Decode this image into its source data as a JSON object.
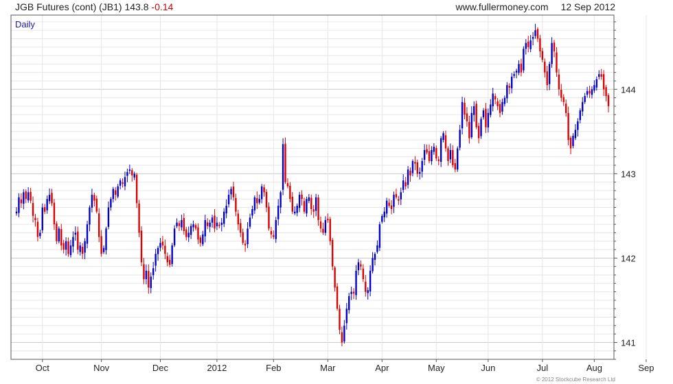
{
  "header": {
    "instrument": "JGB Futures (cont) (JB1)",
    "last": "143.8",
    "change": "-0.14",
    "site": "www.fullermoney.com",
    "date": "12 Sep 2012"
  },
  "footer": {
    "copyright": "© 2012 Stockcube Research Ltd"
  },
  "colors": {
    "up": "#0000cc",
    "down": "#dd0000",
    "grid": "#e6e6e6",
    "major_grid": "#c8c8c8",
    "frame": "#555555"
  },
  "chart_data": {
    "type": "candlestick",
    "title": "Daily",
    "x_tick_labels": [
      "Oct",
      "Nov",
      "Dec",
      "2012",
      "Feb",
      "Mar",
      "Apr",
      "May",
      "Jun",
      "Jul",
      "Aug",
      "Sep"
    ],
    "x_tick_index": [
      11,
      36,
      61,
      85,
      109,
      132,
      155,
      178,
      200,
      223,
      245,
      267
    ],
    "y_ticks": [
      141,
      142,
      143,
      144
    ],
    "ylim": [
      140.8,
      144.88
    ],
    "y_axis_position": "right",
    "grid": true,
    "closes": [
      142.55,
      142.72,
      142.65,
      142.78,
      142.7,
      142.78,
      142.68,
      142.5,
      142.45,
      142.25,
      142.3,
      142.6,
      142.55,
      142.7,
      142.75,
      142.65,
      142.4,
      142.2,
      142.35,
      142.15,
      142.1,
      142.2,
      142.05,
      142.15,
      142.25,
      142.3,
      142.1,
      142.15,
      142.05,
      142.2,
      142.4,
      142.6,
      142.75,
      142.68,
      142.55,
      142.25,
      142.05,
      142.12,
      142.35,
      142.6,
      142.7,
      142.82,
      142.75,
      142.85,
      142.92,
      142.88,
      142.96,
      143.02,
      143.05,
      142.98,
      143.0,
      142.65,
      142.3,
      141.95,
      141.75,
      141.85,
      141.65,
      141.78,
      141.88,
      142.05,
      142.12,
      142.18,
      142.15,
      142.05,
      141.95,
      141.92,
      142.15,
      142.35,
      142.42,
      142.38,
      142.45,
      142.32,
      142.25,
      142.3,
      142.38,
      142.4,
      142.35,
      142.22,
      142.18,
      142.28,
      142.45,
      142.38,
      142.42,
      142.48,
      142.35,
      142.42,
      142.38,
      142.42,
      142.55,
      142.62,
      142.75,
      142.82,
      142.72,
      142.55,
      142.4,
      142.3,
      142.18,
      142.15,
      142.35,
      142.48,
      142.58,
      142.72,
      142.65,
      142.7,
      142.85,
      142.78,
      142.6,
      142.35,
      142.28,
      142.25,
      142.45,
      142.62,
      142.78,
      143.35,
      142.9,
      142.85,
      142.7,
      142.55,
      142.55,
      142.62,
      142.75,
      142.7,
      142.55,
      142.7,
      142.72,
      142.58,
      142.55,
      142.72,
      142.45,
      142.35,
      142.3,
      142.45,
      142.45,
      142.2,
      141.9,
      141.65,
      141.4,
      141.15,
      141.0,
      141.2,
      141.4,
      141.55,
      141.6,
      141.58,
      141.85,
      141.95,
      141.9,
      141.75,
      141.6,
      141.62,
      141.85,
      142.0,
      142.05,
      142.15,
      142.4,
      142.5,
      142.55,
      142.68,
      142.62,
      142.58,
      142.75,
      142.72,
      142.68,
      142.78,
      142.92,
      142.85,
      143.05,
      142.98,
      143.15,
      143.12,
      143.0,
      143.02,
      143.15,
      143.28,
      143.25,
      143.15,
      143.28,
      143.32,
      143.18,
      143.15,
      143.42,
      143.48,
      143.3,
      143.15,
      143.28,
      143.1,
      143.05,
      143.3,
      143.52,
      143.85,
      143.7,
      143.62,
      143.42,
      143.72,
      143.8,
      143.55,
      143.42,
      143.65,
      143.75,
      143.55,
      143.72,
      143.82,
      143.95,
      143.88,
      143.8,
      143.72,
      143.85,
      143.9,
      144.05,
      144.02,
      144.15,
      144.18,
      144.22,
      144.3,
      144.2,
      144.48,
      144.55,
      144.5,
      144.58,
      144.62,
      144.7,
      144.6,
      144.45,
      144.35,
      144.2,
      144.05,
      144.3,
      144.55,
      144.45,
      144.2,
      144.0,
      143.9,
      143.85,
      143.72,
      143.4,
      143.3,
      143.45,
      143.52,
      143.62,
      143.75,
      143.85,
      143.92,
      143.98,
      143.95,
      144.0,
      144.05,
      144.12,
      144.18,
      144.15,
      144.0,
      143.92,
      143.8
    ],
    "series": [
      {
        "name": "JB1",
        "values": "closes"
      }
    ]
  }
}
